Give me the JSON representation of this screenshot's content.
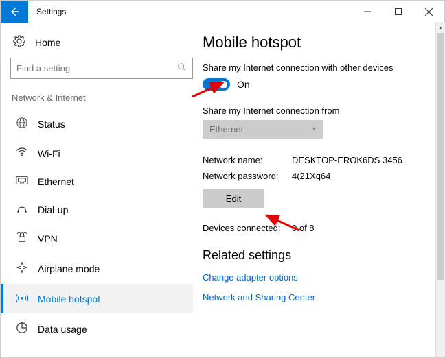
{
  "window": {
    "title": "Settings"
  },
  "sidebar": {
    "home_label": "Home",
    "search_placeholder": "Find a setting",
    "section_label": "Network & Internet",
    "items": [
      {
        "label": "Status"
      },
      {
        "label": "Wi-Fi"
      },
      {
        "label": "Ethernet"
      },
      {
        "label": "Dial-up"
      },
      {
        "label": "VPN"
      },
      {
        "label": "Airplane mode"
      },
      {
        "label": "Mobile hotspot"
      },
      {
        "label": "Data usage"
      }
    ]
  },
  "main": {
    "heading": "Mobile hotspot",
    "share_label": "Share my Internet connection with other devices",
    "toggle_state": "On",
    "share_from_label": "Share my Internet connection from",
    "share_from_value": "Ethernet",
    "network_name_label": "Network name:",
    "network_name_value": "DESKTOP-EROK6DS 3456",
    "network_password_label": "Network password:",
    "network_password_value": "4(21Xq64",
    "edit_label": "Edit",
    "devices_connected_label": "Devices connected:",
    "devices_connected_value": "0 of 8",
    "related_heading": "Related settings",
    "link1": "Change adapter options",
    "link2": "Network and Sharing Center"
  }
}
